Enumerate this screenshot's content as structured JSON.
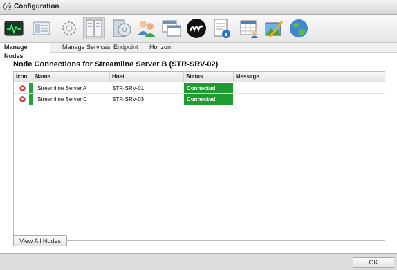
{
  "window": {
    "title": "Configuration"
  },
  "toolbar": {
    "icons": [
      "monitor-icon",
      "server-card-icon",
      "gear-icon",
      "nodes-panel-icon",
      "disk-package-icon",
      "users-icon",
      "windows-icon",
      "streamline-logo-icon",
      "document-info-icon",
      "calendar-user-icon",
      "edit-image-icon",
      "globe-icon"
    ],
    "selected_index": 3
  },
  "tabs": [
    {
      "label": "Manage Nodes",
      "active": true
    },
    {
      "label": "Manage Services",
      "active": false
    },
    {
      "label": "Endpoint",
      "active": false
    },
    {
      "label": "Horizon",
      "active": false
    }
  ],
  "heading": "Node Connections for Streamline Server B (STR-SRV-02)",
  "table": {
    "columns": [
      "Icon",
      "Name",
      "Host",
      "Status",
      "Message"
    ],
    "rows": [
      {
        "name": "Streamline Server A",
        "host": "STR-SRV-01",
        "status": "Connected",
        "message": ""
      },
      {
        "name": "Streamline Server C",
        "host": "STR-SRV-03",
        "status": "Connected",
        "message": ""
      }
    ]
  },
  "buttons": {
    "view_all": "View All Nodes",
    "ok": "OK"
  },
  "colors": {
    "connected": "#1e9c2f",
    "selected_icon_bg": "#d9d9d9"
  }
}
